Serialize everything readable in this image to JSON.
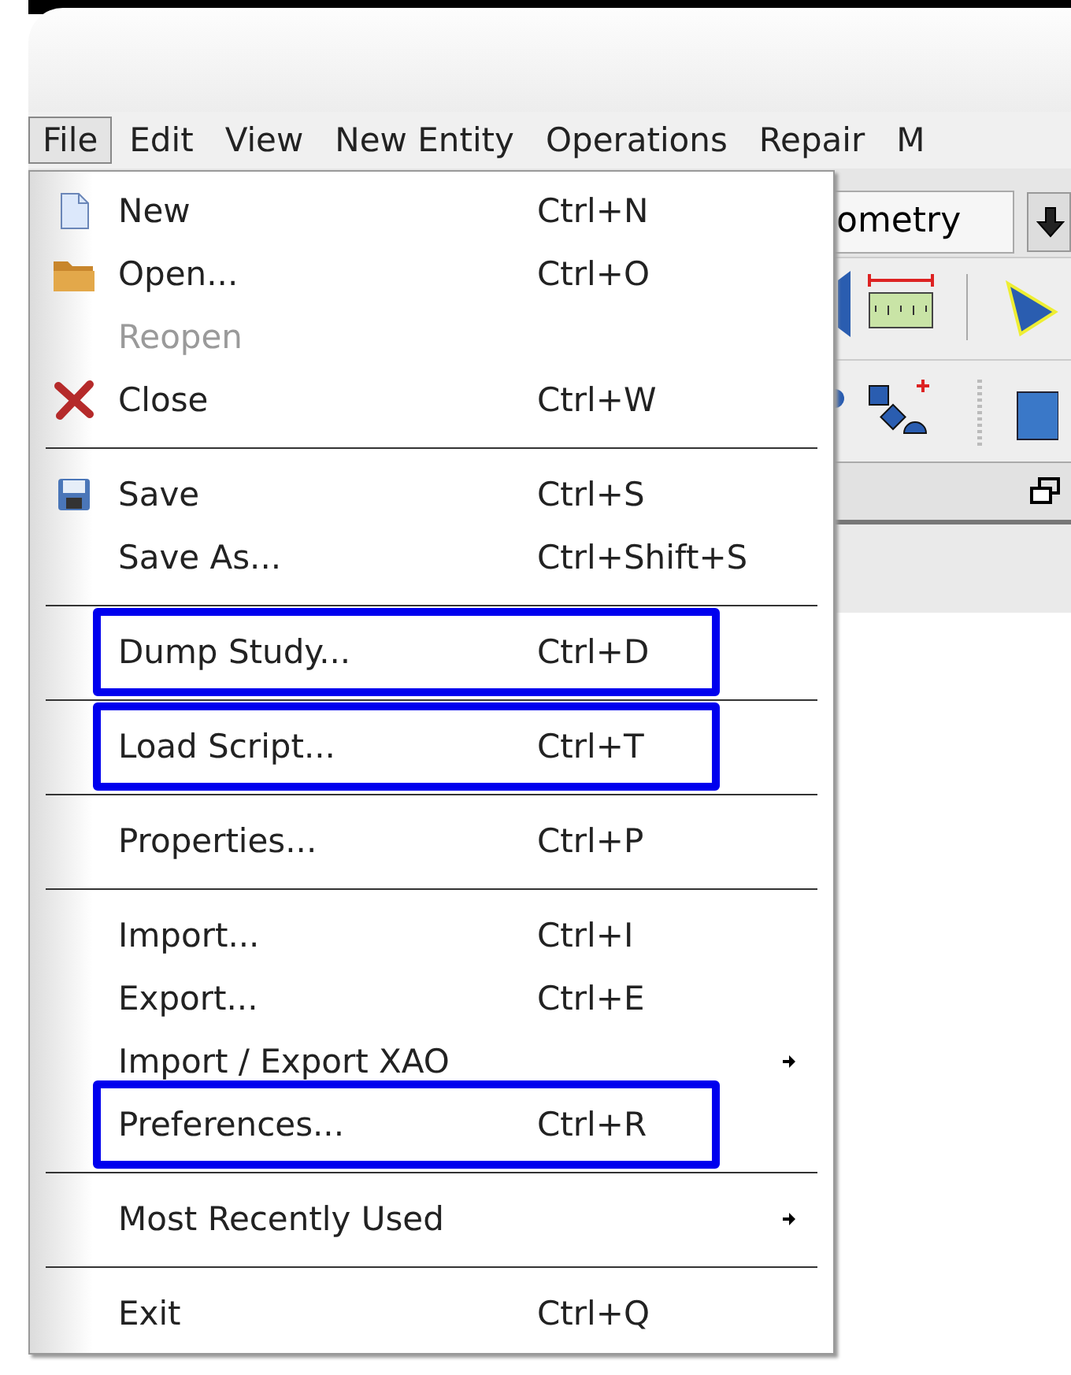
{
  "menubar": [
    {
      "label": "File",
      "selected": true
    },
    {
      "label": "Edit",
      "selected": false
    },
    {
      "label": "View",
      "selected": false
    },
    {
      "label": "New Entity",
      "selected": false
    },
    {
      "label": "Operations",
      "selected": false
    },
    {
      "label": "Repair",
      "selected": false
    },
    {
      "label": "M",
      "selected": false
    }
  ],
  "toolbar": {
    "combo_value": "ometry"
  },
  "file_menu": [
    {
      "kind": "item",
      "label": "New",
      "shortcut": "Ctrl+N",
      "disabled": false,
      "highlighted": false
    },
    {
      "kind": "item",
      "label": "Open...",
      "shortcut": "Ctrl+O",
      "disabled": false,
      "highlighted": false
    },
    {
      "kind": "item",
      "label": "Reopen",
      "disabled": true,
      "highlighted": false
    },
    {
      "kind": "item",
      "label": "Close",
      "shortcut": "Ctrl+W",
      "disabled": false,
      "highlighted": false
    },
    {
      "kind": "separator"
    },
    {
      "kind": "item",
      "label": "Save",
      "shortcut": "Ctrl+S",
      "disabled": false,
      "highlighted": false
    },
    {
      "kind": "item",
      "label": "Save As...",
      "shortcut": "Ctrl+Shift+S",
      "disabled": false,
      "highlighted": false
    },
    {
      "kind": "separator"
    },
    {
      "kind": "item",
      "label": "Dump Study...",
      "shortcut": "Ctrl+D",
      "disabled": false,
      "highlighted": true
    },
    {
      "kind": "separator"
    },
    {
      "kind": "item",
      "label": "Load Script...",
      "shortcut": "Ctrl+T",
      "disabled": false,
      "highlighted": true
    },
    {
      "kind": "separator"
    },
    {
      "kind": "item",
      "label": "Properties...",
      "shortcut": "Ctrl+P",
      "disabled": false,
      "highlighted": false
    },
    {
      "kind": "separator"
    },
    {
      "kind": "item",
      "label": "Import...",
      "shortcut": "Ctrl+I",
      "disabled": false,
      "highlighted": false
    },
    {
      "kind": "item",
      "label": "Export...",
      "shortcut": "Ctrl+E",
      "disabled": false,
      "highlighted": false
    },
    {
      "kind": "submenu",
      "label": "Import / Export XAO",
      "disabled": false,
      "highlighted": false
    },
    {
      "kind": "item",
      "label": "Preferences...",
      "shortcut": "Ctrl+R",
      "disabled": false,
      "highlighted": true
    },
    {
      "kind": "separator"
    },
    {
      "kind": "submenu",
      "label": "Most Recently Used",
      "disabled": false,
      "highlighted": false
    },
    {
      "kind": "separator"
    },
    {
      "kind": "item",
      "label": "Exit",
      "shortcut": "Ctrl+Q",
      "disabled": false,
      "highlighted": false
    }
  ]
}
